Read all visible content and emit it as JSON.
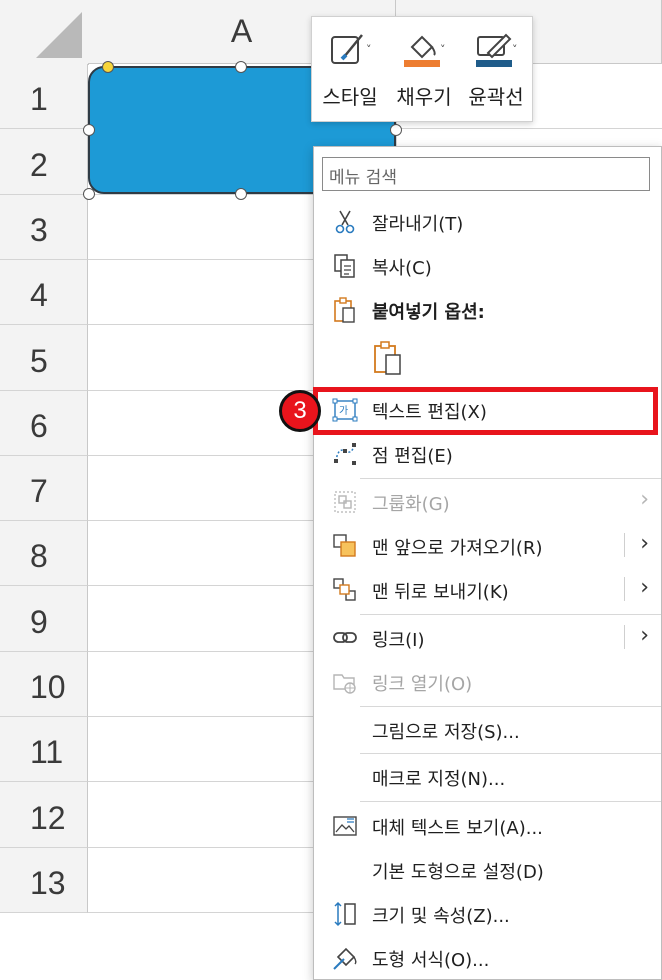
{
  "sheet": {
    "column": "A",
    "rows": [
      "1",
      "2",
      "3",
      "4",
      "5",
      "6",
      "7",
      "8",
      "9",
      "10",
      "11",
      "12",
      "13"
    ]
  },
  "mini_toolbar": {
    "style": "스타일",
    "fill": "채우기",
    "outline": "윤곽선",
    "fill_color": "#ed7d31",
    "outline_color": "#1f5c8a"
  },
  "menu": {
    "search_placeholder": "메뉴 검색",
    "cut": "잘라내기(T)",
    "copy": "복사(C)",
    "paste_options": "붙여넣기 옵션:",
    "edit_text": "텍스트 편집(X)",
    "edit_points": "점 편집(E)",
    "group": "그룹화(G)",
    "bring_to_front": "맨 앞으로 가져오기(R)",
    "send_to_back": "맨 뒤로 보내기(K)",
    "link": "링크(I)",
    "open_link": "링크 열기(O)",
    "save_as_picture": "그림으로 저장(S)...",
    "assign_macro": "매크로 지정(N)...",
    "alt_text": "대체 텍스트 보기(A)...",
    "set_default": "기본 도형으로 설정(D)",
    "size_properties": "크기 및 속성(Z)...",
    "format_shape": "도형 서식(O)..."
  },
  "step_badge": "3",
  "colors": {
    "shape_fill": "#1d9ad6",
    "highlight": "#e8141c"
  }
}
